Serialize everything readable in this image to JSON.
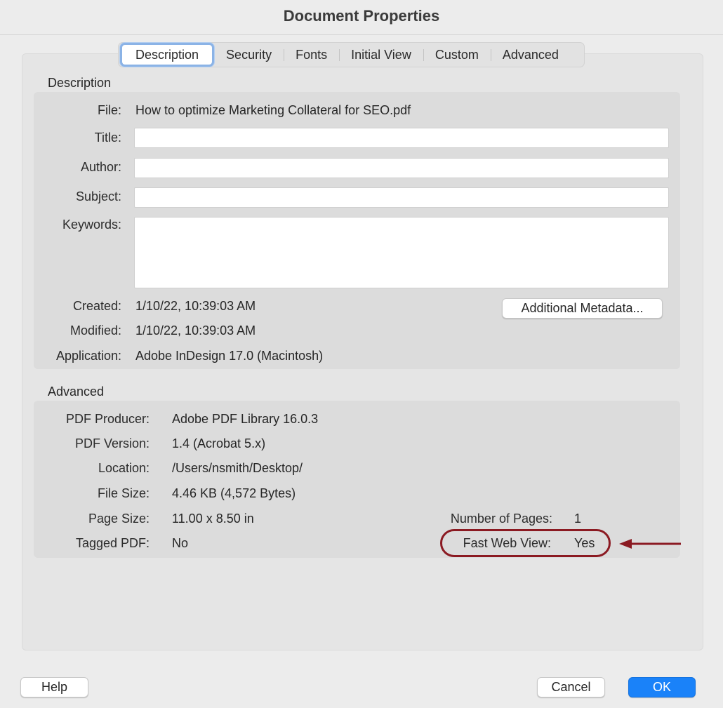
{
  "window": {
    "title": "Document Properties"
  },
  "tabs": [
    {
      "label": "Description",
      "active": true
    },
    {
      "label": "Security",
      "active": false
    },
    {
      "label": "Fonts",
      "active": false
    },
    {
      "label": "Initial View",
      "active": false
    },
    {
      "label": "Custom",
      "active": false
    },
    {
      "label": "Advanced",
      "active": false
    }
  ],
  "description": {
    "section_label": "Description",
    "file_label": "File:",
    "file_value": "How to optimize Marketing Collateral for SEO.pdf",
    "title_label": "Title:",
    "title_value": "",
    "author_label": "Author:",
    "author_value": "",
    "subject_label": "Subject:",
    "subject_value": "",
    "keywords_label": "Keywords:",
    "keywords_value": "",
    "created_label": "Created:",
    "created_value": "1/10/22, 10:39:03 AM",
    "modified_label": "Modified:",
    "modified_value": "1/10/22, 10:39:03 AM",
    "application_label": "Application:",
    "application_value": "Adobe InDesign 17.0 (Macintosh)",
    "additional_metadata_label": "Additional Metadata..."
  },
  "advanced": {
    "section_label": "Advanced",
    "pdf_producer_label": "PDF Producer:",
    "pdf_producer_value": "Adobe PDF Library 16.0.3",
    "pdf_version_label": "PDF Version:",
    "pdf_version_value": "1.4 (Acrobat 5.x)",
    "location_label": "Location:",
    "location_value": "/Users/nsmith/Desktop/",
    "file_size_label": "File Size:",
    "file_size_value": "4.46 KB (4,572 Bytes)",
    "page_size_label": "Page Size:",
    "page_size_value": "11.00 x 8.50 in",
    "tagged_pdf_label": "Tagged PDF:",
    "tagged_pdf_value": "No",
    "number_of_pages_label": "Number of Pages:",
    "number_of_pages_value": "1",
    "fast_web_view_label": "Fast Web View:",
    "fast_web_view_value": "Yes"
  },
  "footer": {
    "help_label": "Help",
    "cancel_label": "Cancel",
    "ok_label": "OK"
  },
  "annotation": {
    "color": "#8b1a22"
  }
}
